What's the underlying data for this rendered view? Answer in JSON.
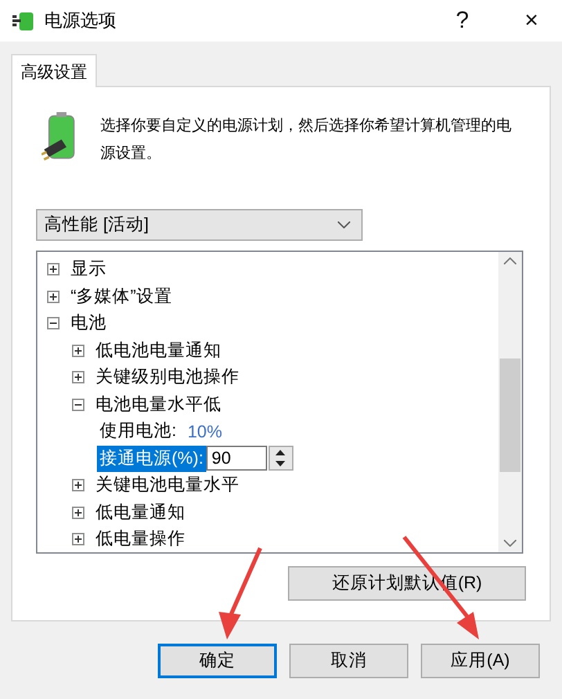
{
  "window": {
    "title": "电源选项",
    "help": "?",
    "close": "×"
  },
  "tabs": [
    {
      "label": "高级设置",
      "selected": true
    }
  ],
  "description": "选择你要自定义的电源计划，然后选择你希望计算机管理的电源设置。",
  "plan_dropdown": {
    "value": "高性能 [活动]"
  },
  "settings_tree": [
    {
      "label": "显示",
      "expanded": false
    },
    {
      "label": "“多媒体”设置",
      "expanded": false
    },
    {
      "label": "电池",
      "expanded": true,
      "children": [
        {
          "label": "低电池电量通知",
          "expanded": false
        },
        {
          "label": "关键级别电池操作",
          "expanded": false
        },
        {
          "label": "电池电量水平低",
          "expanded": true,
          "children": [
            {
              "kind": "value",
              "label": "使用电池:",
              "value": "10%",
              "selected": false
            },
            {
              "kind": "spin",
              "label": "接通电源(%):",
              "value": "90",
              "selected": true
            }
          ]
        },
        {
          "label": "关键电池电量水平",
          "expanded": false
        },
        {
          "label": "低电量通知",
          "expanded": false
        },
        {
          "label": "低电量操作",
          "expanded": false
        }
      ]
    }
  ],
  "restore_button": "还原计划默认值(R)",
  "buttons": [
    {
      "label": "确定",
      "default": true
    },
    {
      "label": "取消",
      "default": false
    },
    {
      "label": "应用(A)",
      "default": false
    }
  ]
}
